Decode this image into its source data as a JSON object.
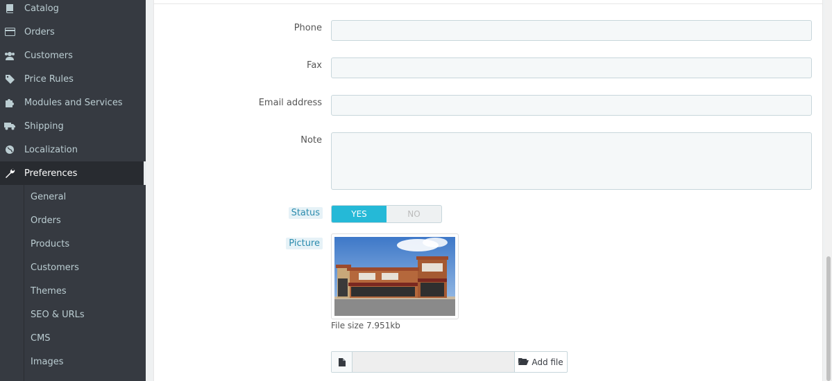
{
  "sidebar": {
    "menu": [
      {
        "label": "Catalog",
        "icon": "book-icon"
      },
      {
        "label": "Orders",
        "icon": "credit-card-icon"
      },
      {
        "label": "Customers",
        "icon": "users-icon"
      },
      {
        "label": "Price Rules",
        "icon": "tags-icon"
      },
      {
        "label": "Modules and Services",
        "icon": "puzzle-icon"
      },
      {
        "label": "Shipping",
        "icon": "truck-icon"
      },
      {
        "label": "Localization",
        "icon": "globe-icon"
      },
      {
        "label": "Preferences",
        "icon": "wrench-icon"
      }
    ],
    "submenu": [
      "General",
      "Orders",
      "Products",
      "Customers",
      "Themes",
      "SEO & URLs",
      "CMS",
      "Images"
    ]
  },
  "form": {
    "phone_label": "Phone",
    "fax_label": "Fax",
    "email_label": "Email address",
    "note_label": "Note",
    "status_label": "Status",
    "status_yes": "YES",
    "status_no": "NO",
    "picture_label": "Picture",
    "file_size": "File size 7.951kb",
    "add_file": "Add file"
  },
  "colors": {
    "sidebar_bg": "#363a41",
    "active_bg": "#282b30",
    "accent": "#25b9d7",
    "hint_text": "#2b8bad"
  }
}
